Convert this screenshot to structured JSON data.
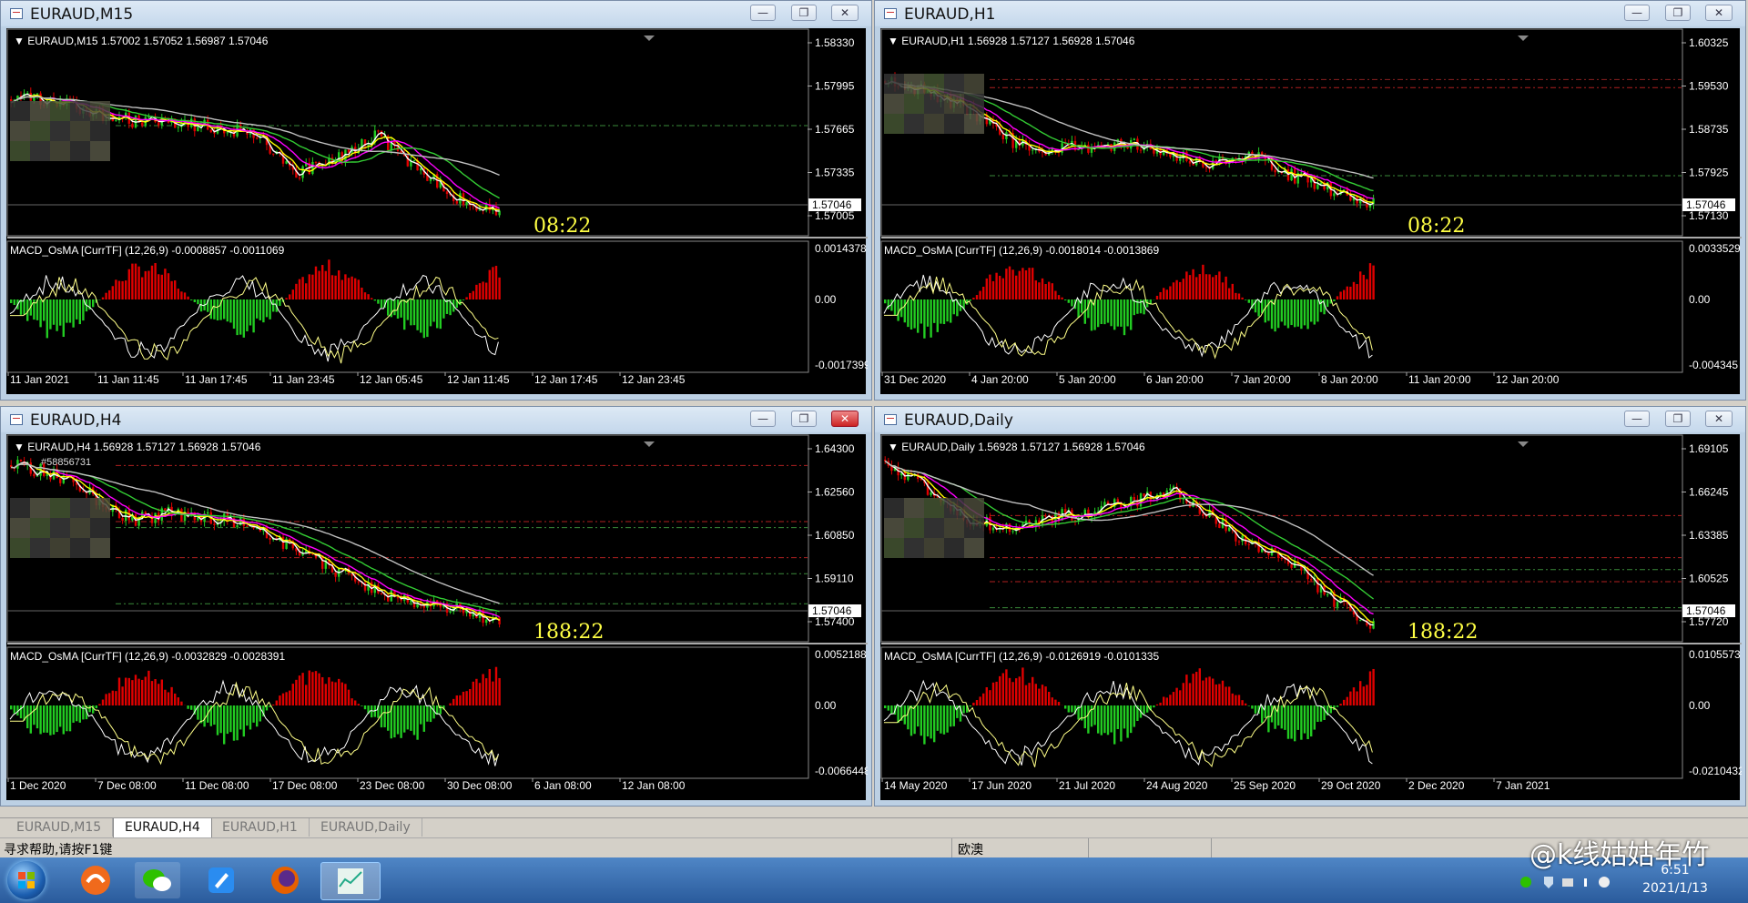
{
  "windows": [
    {
      "id": "m15",
      "title": "EURAUD,M15",
      "header": "EURAUD,M15  1.57002 1.57052 1.56987 1.57046",
      "prices": [
        "1.58330",
        "1.57995",
        "1.57665",
        "1.57335",
        "1.57005"
      ],
      "last_price": "1.57046",
      "clock": "08:22",
      "macd_label": "MACD_OsMA [CurrTF] (12,26,9) -0.0008857 -0.0011069",
      "macd_scale": [
        "0.0014378",
        "0.00",
        "-0.0017399"
      ],
      "dates": [
        "11 Jan 2021",
        "11 Jan 11:45",
        "11 Jan 17:45",
        "11 Jan 23:45",
        "12 Jan 05:45",
        "12 Jan 11:45",
        "12 Jan 17:45",
        "12 Jan 23:45"
      ],
      "close_style": "normal"
    },
    {
      "id": "h1",
      "title": "EURAUD,H1",
      "header": "EURAUD,H1  1.56928 1.57127 1.56928 1.57046",
      "prices": [
        "1.60325",
        "1.59530",
        "1.58735",
        "1.57925",
        "1.57130"
      ],
      "last_price": "1.57046",
      "clock": "08:22",
      "macd_label": "MACD_OsMA [CurrTF] (12,26,9) -0.0018014 -0.0013869",
      "macd_scale": [
        "0.0033529",
        "0.00",
        "-0.004345"
      ],
      "dates": [
        "31 Dec 2020",
        "4 Jan 20:00",
        "5 Jan 20:00",
        "6 Jan 20:00",
        "7 Jan 20:00",
        "8 Jan 20:00",
        "11 Jan 20:00",
        "12 Jan 20:00"
      ],
      "close_style": "normal"
    },
    {
      "id": "h4",
      "title": "EURAUD,H4",
      "header": "EURAUD,H4  1.56928 1.57127 1.56928 1.57046",
      "prices": [
        "1.64300",
        "1.62560",
        "1.60850",
        "1.59110",
        "1.57400"
      ],
      "last_price": "1.57046",
      "clock": "188:22",
      "macd_label": "MACD_OsMA [CurrTF] (12,26,9) -0.0032829 -0.0028391",
      "macd_scale": [
        "0.0052188",
        "0.00",
        "-0.0066448"
      ],
      "dates": [
        "1 Dec 2020",
        "7 Dec 08:00",
        "11 Dec 08:00",
        "17 Dec 08:00",
        "23 Dec 08:00",
        "30 Dec 08:00",
        "6 Jan 08:00",
        "12 Jan 08:00"
      ],
      "close_style": "red"
    },
    {
      "id": "d1",
      "title": "EURAUD,Daily",
      "header": "EURAUD,Daily  1.56928 1.57127 1.56928 1.57046",
      "prices": [
        "1.69105",
        "1.66245",
        "1.63385",
        "1.60525",
        "1.57720"
      ],
      "last_price": "1.57046",
      "clock": "188:22",
      "macd_label": "MACD_OsMA [CurrTF] (12,26,9) -0.0126919 -0.0101335",
      "macd_scale": [
        "0.0105573",
        "0.00",
        "-0.0210432"
      ],
      "dates": [
        "14 May 2020",
        "17 Jun 2020",
        "21 Jul 2020",
        "24 Aug 2020",
        "25 Sep 2020",
        "29 Oct 2020",
        "2 Dec 2020",
        "7 Jan 2021"
      ],
      "close_style": "normal"
    }
  ],
  "h4_extra_label": "#58856731",
  "tabs": [
    "EURAUD,M15",
    "EURAUD,H4",
    "EURAUD,H1",
    "EURAUD,Daily"
  ],
  "active_tab": "EURAUD,H4",
  "status": {
    "help": "寻求帮助,请按F1键",
    "symbol": "欧澳"
  },
  "watermark": "@k线姑姑年竹",
  "clock": {
    "time": "6:51",
    "date": "2021/1/13"
  },
  "colors": {
    "bull": "#e00000",
    "bear": "#22cc22",
    "fast_ma": "#ffffff",
    "yellow_ma": "#ffff00",
    "magenta_ma": "#ff00ff",
    "green_ma": "#33cc33",
    "gray_ma": "#c0c0c0",
    "signal": "#ffff88"
  }
}
